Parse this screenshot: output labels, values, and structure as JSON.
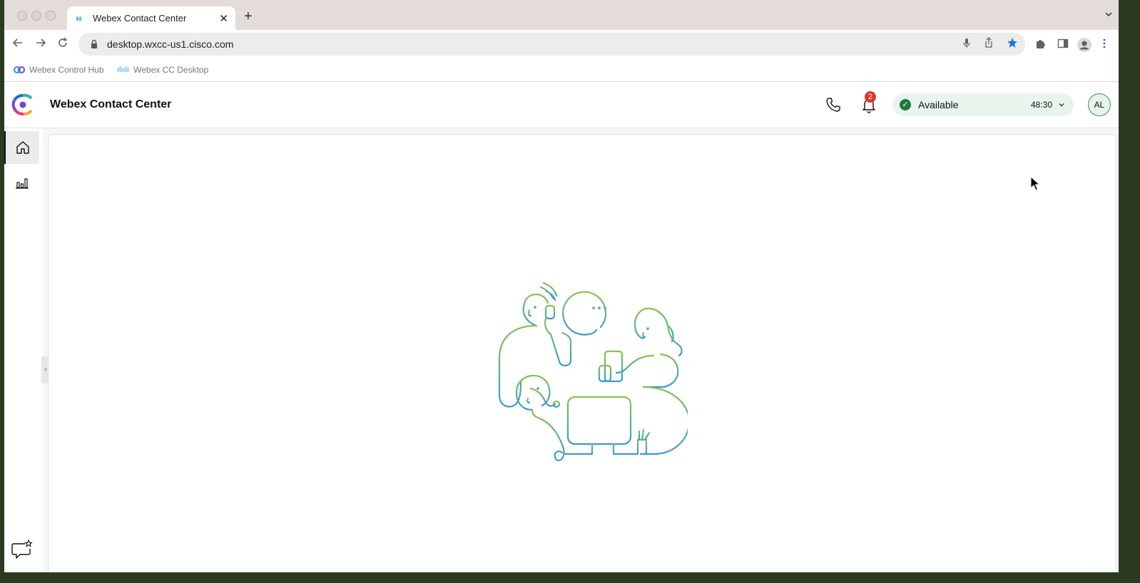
{
  "browser": {
    "tab": {
      "favicon": "cisco-icon",
      "title": "Webex Contact Center",
      "close": "✕"
    },
    "new_tab": "+",
    "address": {
      "url": "desktop.wxcc-us1.cisco.com"
    },
    "bookmarks": [
      {
        "label": "Webex Control Hub",
        "icon": "webex-icon"
      },
      {
        "label": "Webex CC Desktop",
        "icon": "cisco-icon"
      }
    ]
  },
  "app": {
    "title": "Webex Contact Center",
    "notifications": {
      "count": "2"
    },
    "agent_state": {
      "label": "Available",
      "timer": "48:30"
    },
    "avatar": {
      "initials": "AL"
    }
  },
  "sidebar": {
    "items": [
      {
        "name": "home",
        "icon": "home-icon",
        "active": true
      },
      {
        "name": "statistics",
        "icon": "bar-chart-icon",
        "active": false
      }
    ],
    "bottom": {
      "icon": "feedback-icon"
    }
  },
  "colors": {
    "accent": "#1f7a3a",
    "badge": "#d93829",
    "illustration_gradient": [
      "#7bc24a",
      "#3a9ad1"
    ]
  }
}
